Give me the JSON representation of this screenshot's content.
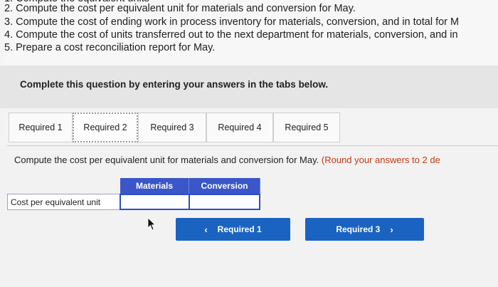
{
  "instructions_list": [
    "2. Compute the cost per equivalent unit for materials and conversion for May.",
    "3. Compute the cost of ending work in process inventory for materials, conversion, and in total for M",
    "4. Compute the cost of units transferred out to the next department for materials, conversion, and in",
    "5. Prepare a cost reconciliation report for May."
  ],
  "instruction": "Complete this question by entering your answers in the tabs below.",
  "tabs": [
    {
      "label": "Required 1"
    },
    {
      "label": "Required 2"
    },
    {
      "label": "Required 3"
    },
    {
      "label": "Required 4"
    },
    {
      "label": "Required 5"
    }
  ],
  "active_tab_index": 1,
  "question": {
    "text": "Compute the cost per equivalent unit for materials and conversion for May.",
    "round_note": "(Round your answers to 2 de"
  },
  "table": {
    "headers": [
      "Materials",
      "Conversion"
    ],
    "row_label": "Cost per equivalent unit",
    "values": [
      "",
      ""
    ]
  },
  "nav": {
    "prev_label": "Required 1",
    "next_label": "Required 3",
    "prev_icon": "chevron-left-icon",
    "next_icon": "chevron-right-icon"
  },
  "colors": {
    "table_header": "#3a56c8",
    "button": "#1a63c1",
    "round_note": "#c03a14"
  }
}
